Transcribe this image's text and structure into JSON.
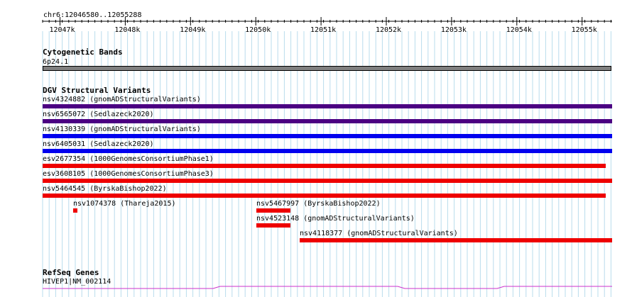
{
  "ruler": {
    "region_label": "chr6:12046580..12055288",
    "ticks": [
      "12047k",
      "12048k",
      "12049k",
      "12050k",
      "12051k",
      "12052k",
      "12053k",
      "12054k",
      "12055k"
    ]
  },
  "cytoband_track": {
    "title": "Cytogenetic Bands",
    "band_label": "6p24.1",
    "band_color": "#808080"
  },
  "dgv_track": {
    "title": "DGV Structural Variants",
    "features": [
      {
        "label": "nsv4324882 (gnomADStructuralVariants)",
        "color": "#4b0082"
      },
      {
        "label": "nsv6565072 (Sedlazeck2020)",
        "color": "#4b0082"
      },
      {
        "label": "nsv4130339 (gnomADStructuralVariants)",
        "color": "#0000ee"
      },
      {
        "label": "nsv6405031 (Sedlazeck2020)",
        "color": "#0000ee"
      },
      {
        "label": "esv2677354 (1000GenomesConsortiumPhase1)",
        "color": "#ee0000"
      },
      {
        "label": "esv3608105 (1000GenomesConsortiumPhase3)",
        "color": "#ee0000"
      },
      {
        "label": "nsv5464545 (ByrskaBishop2022)",
        "color": "#ee0000"
      },
      {
        "label": "nsv1074378 (Thareja2015)",
        "color": "#ee0000"
      },
      {
        "label": "nsv5467997 (ByrskaBishop2022)",
        "color": "#ee0000"
      },
      {
        "label": "nsv4523148 (gnomADStructuralVariants)",
        "color": "#ee0000"
      },
      {
        "label": "nsv4118377 (gnomADStructuralVariants)",
        "color": "#ee0000"
      }
    ]
  },
  "refseq_track": {
    "title": "RefSeq Genes",
    "gene_label": "HIVEP1|NM_002114",
    "gene_color": "#cc33cc"
  },
  "colors": {
    "grid_line": "#b9dcec",
    "tick_line": "#000000"
  }
}
